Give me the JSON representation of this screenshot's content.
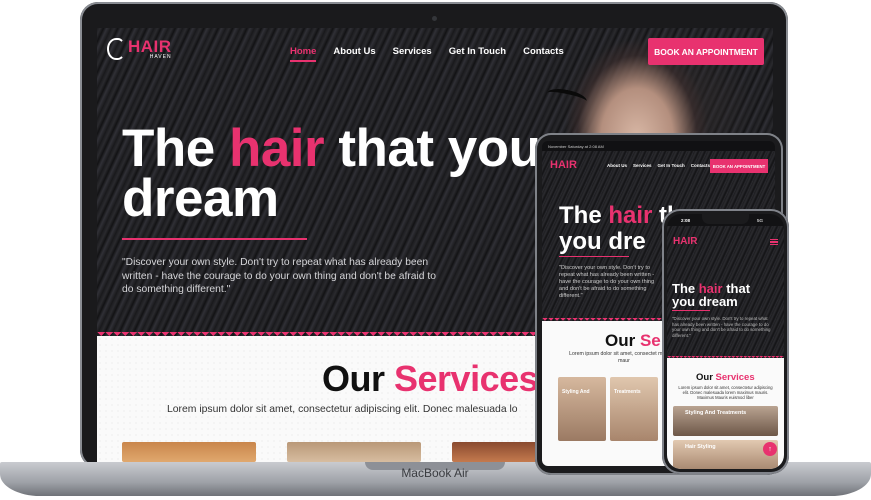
{
  "brand": {
    "logo_main": "HAIR",
    "logo_sub": "HAVEN",
    "accent_color": "#e8326f"
  },
  "desktop": {
    "nav": {
      "items": [
        "Home",
        "About Us",
        "Services",
        "Get In Touch",
        "Contacts"
      ],
      "active": "Home",
      "cta": "BOOK AN APPOINTMENT"
    },
    "hero": {
      "title_part1": "The ",
      "title_highlight": "hair",
      "title_part2": " that you dream",
      "quote": "\"Discover your own style. Don't try to repeat what has already been written - have the courage to do your own thing and don't be afraid to do something different.\""
    },
    "services": {
      "title_part1": "Our ",
      "title_highlight": "Services",
      "subtitle": "Lorem ipsum dolor sit amet, consectetur adipiscing elit. Donec malesuada lo"
    },
    "device_label": "MacBook Air"
  },
  "tablet": {
    "status": "November Saturday at 2:08 AM",
    "logo": "HAIR",
    "nav": [
      "About Us",
      "Services",
      "Get In Touch",
      "Contacts"
    ],
    "cta": "BOOK AN APPOINTMENT",
    "hero_line1_a": "The ",
    "hero_line1_highlight": "hair",
    "hero_line1_b": " th",
    "hero_line2": "you dre",
    "quote": "\"Discover your own style. Don't try to repeat what has already been written - have the courage to do your own thing and don't be afraid to do something different.\"",
    "services_title_a": "Our ",
    "services_title_highlight": "Se",
    "services_sub": "Lorem ipsum dolor sit amet, consectet maximus maur",
    "cards": [
      "Styling And",
      "Treatments"
    ]
  },
  "phone": {
    "time": "2:08",
    "signal": "5G",
    "logo": "HAIR",
    "hero_title_a": "The ",
    "hero_title_highlight": "hair",
    "hero_title_b": " that you dream",
    "quote": "\"Discover your own style. Don't try to repeat what has already been written - have the courage to do your own thing and don't be afraid to do something different.\"",
    "services_title_a": "Our ",
    "services_title_highlight": "Services",
    "services_sub": "Lorem ipsum dolor sit amet, consectetur adipiscing elit. Donec malesuada lorem maximus mauris. Maximus Mauris euismod liber",
    "cards": [
      "Styling And Treatments",
      "Hair Styling"
    ],
    "fab": "↑"
  }
}
